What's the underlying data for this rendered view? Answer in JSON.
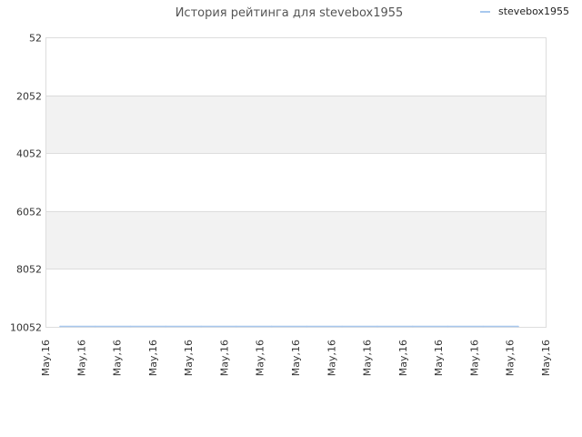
{
  "chart_data": {
    "type": "line",
    "title": "История рейтинга для stevebox1955",
    "legend_position": "top-right",
    "series": [
      {
        "name": "stevebox1955",
        "color": "#a8c8ee",
        "x": [
          "May,16",
          "May,16",
          "May,16",
          "May,16",
          "May,16",
          "May,16",
          "May,16",
          "May,16",
          "May,16",
          "May,16",
          "May,16",
          "May,16",
          "May,16",
          "May,16"
        ],
        "values": [
          10052,
          10052,
          10052,
          10052,
          10052,
          10052,
          10052,
          10052,
          10052,
          10052,
          10052,
          10052,
          10052,
          10052
        ]
      }
    ],
    "y_inverted": true,
    "ylim": [
      52,
      10052
    ],
    "yticks": [
      "52",
      "2052",
      "4052",
      "6052",
      "8052",
      "10052"
    ],
    "xticks": [
      "May,16",
      "May,16",
      "May,16",
      "May,16",
      "May,16",
      "May,16",
      "May,16",
      "May,16",
      "May,16",
      "May,16",
      "May,16",
      "May,16",
      "May,16",
      "May,16",
      "May,16"
    ],
    "grid": true,
    "band_color": "#f2f2f2",
    "grid_color": "#dddddd"
  }
}
